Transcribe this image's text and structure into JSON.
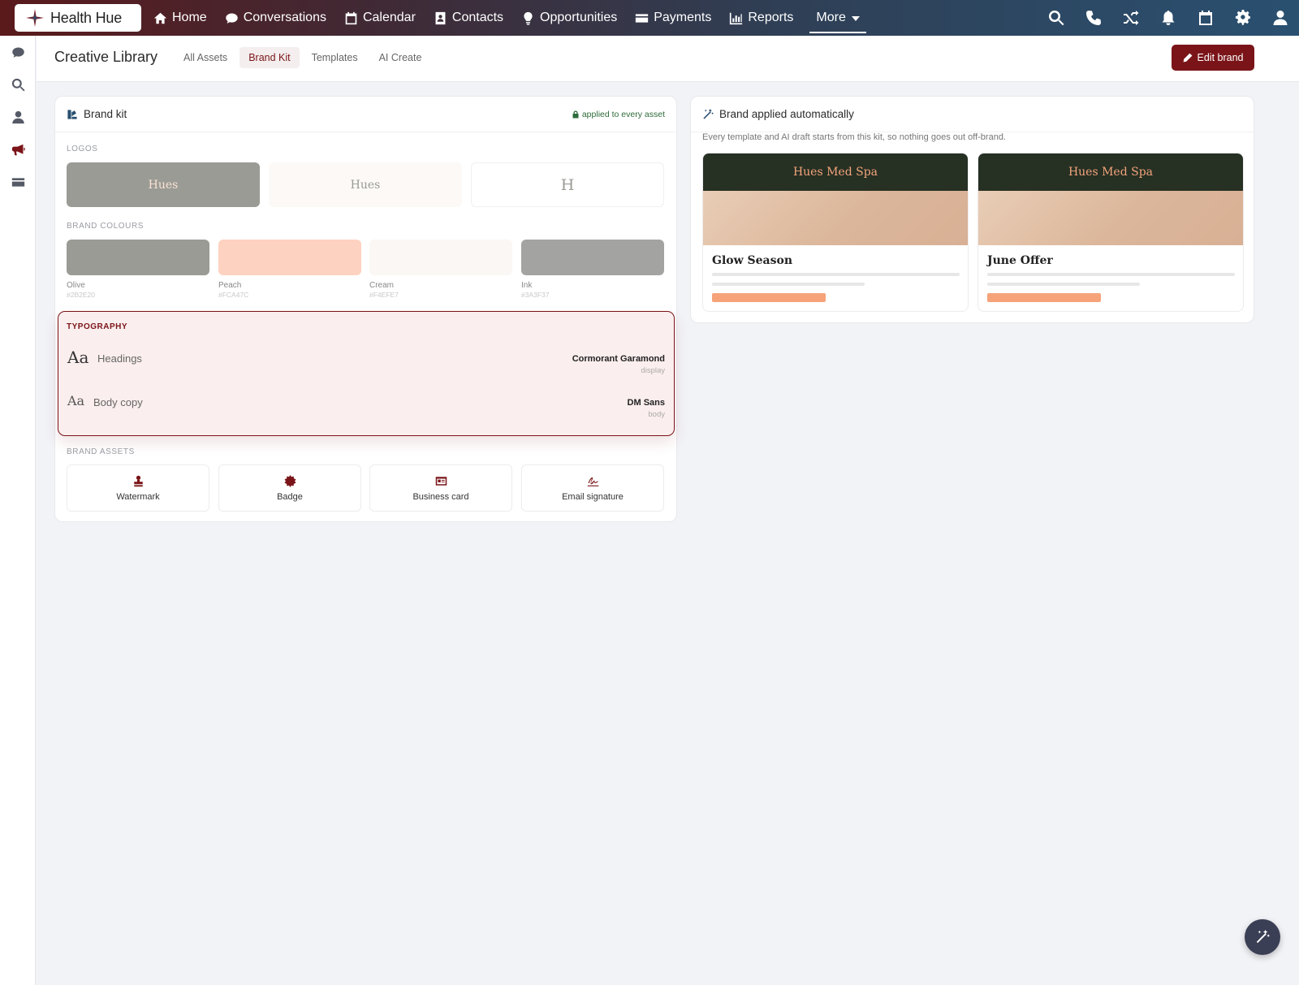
{
  "app": {
    "name": "Health Hue"
  },
  "nav": {
    "items": [
      {
        "label": "Home",
        "icon": "home-icon"
      },
      {
        "label": "Conversations",
        "icon": "chat-icon"
      },
      {
        "label": "Calendar",
        "icon": "calendar-icon"
      },
      {
        "label": "Contacts",
        "icon": "contact-card-icon"
      },
      {
        "label": "Opportunities",
        "icon": "lightbulb-icon"
      },
      {
        "label": "Payments",
        "icon": "credit-card-icon"
      },
      {
        "label": "Reports",
        "icon": "bar-chart-icon"
      }
    ],
    "more_label": "More",
    "right_icons": [
      "search-icon",
      "phone-icon",
      "shuffle-icon",
      "bell-icon",
      "calendar-icon",
      "gear-icon",
      "user-icon"
    ]
  },
  "rail": {
    "icons": [
      "chat-icon",
      "search-icon",
      "user-icon",
      "megaphone-icon",
      "credit-card-icon"
    ],
    "active": "megaphone-icon"
  },
  "subheader": {
    "title": "Creative Library",
    "tabs": [
      {
        "label": "All Assets",
        "active": false
      },
      {
        "label": "Brand Kit",
        "active": true
      },
      {
        "label": "Templates",
        "active": false
      },
      {
        "label": "AI Create",
        "active": false
      }
    ],
    "edit_button": "Edit brand"
  },
  "brand_kit": {
    "title": "Brand kit",
    "applied_note": "applied to every asset",
    "logos_label": "LOGOS",
    "logos": [
      {
        "text": "Hues"
      },
      {
        "text": "Hues"
      },
      {
        "text": "H"
      }
    ],
    "colours_label": "BRAND COLOURS",
    "colours": [
      {
        "name": "Olive",
        "hex": "#2B2E20",
        "display": "#9a9b95"
      },
      {
        "name": "Peach",
        "hex": "#FCA47C",
        "display": "#fdd2c0"
      },
      {
        "name": "Cream",
        "hex": "#F4EFE7",
        "display": "#fbf7f4"
      },
      {
        "name": "Ink",
        "hex": "#3A3F37",
        "display": "#a3a4a2"
      }
    ],
    "typography": {
      "label": "TYPOGRAPHY",
      "rows": [
        {
          "sample": "Aa",
          "name": "Headings",
          "font": "Cormorant Garamond",
          "role": "display"
        },
        {
          "sample": "Aa",
          "name": "Body copy",
          "font": "DM Sans",
          "role": "body"
        }
      ]
    },
    "assets_label": "BRAND ASSETS",
    "assets": [
      {
        "label": "Watermark",
        "icon": "stamp-icon"
      },
      {
        "label": "Badge",
        "icon": "badge-icon"
      },
      {
        "label": "Business card",
        "icon": "id-card-icon"
      },
      {
        "label": "Email signature",
        "icon": "signature-icon"
      }
    ]
  },
  "auto_brand": {
    "title": "Brand applied automatically",
    "description": "Every template and AI draft starts from this kit, so nothing goes out off-brand.",
    "templates": [
      {
        "brand": "Hues Med Spa",
        "title": "Glow Season"
      },
      {
        "brand": "Hues Med Spa",
        "title": "June Offer"
      }
    ]
  },
  "colors": {
    "accent": "#7a1418",
    "success": "#2e6b3a",
    "cta": "#f6a37a"
  }
}
